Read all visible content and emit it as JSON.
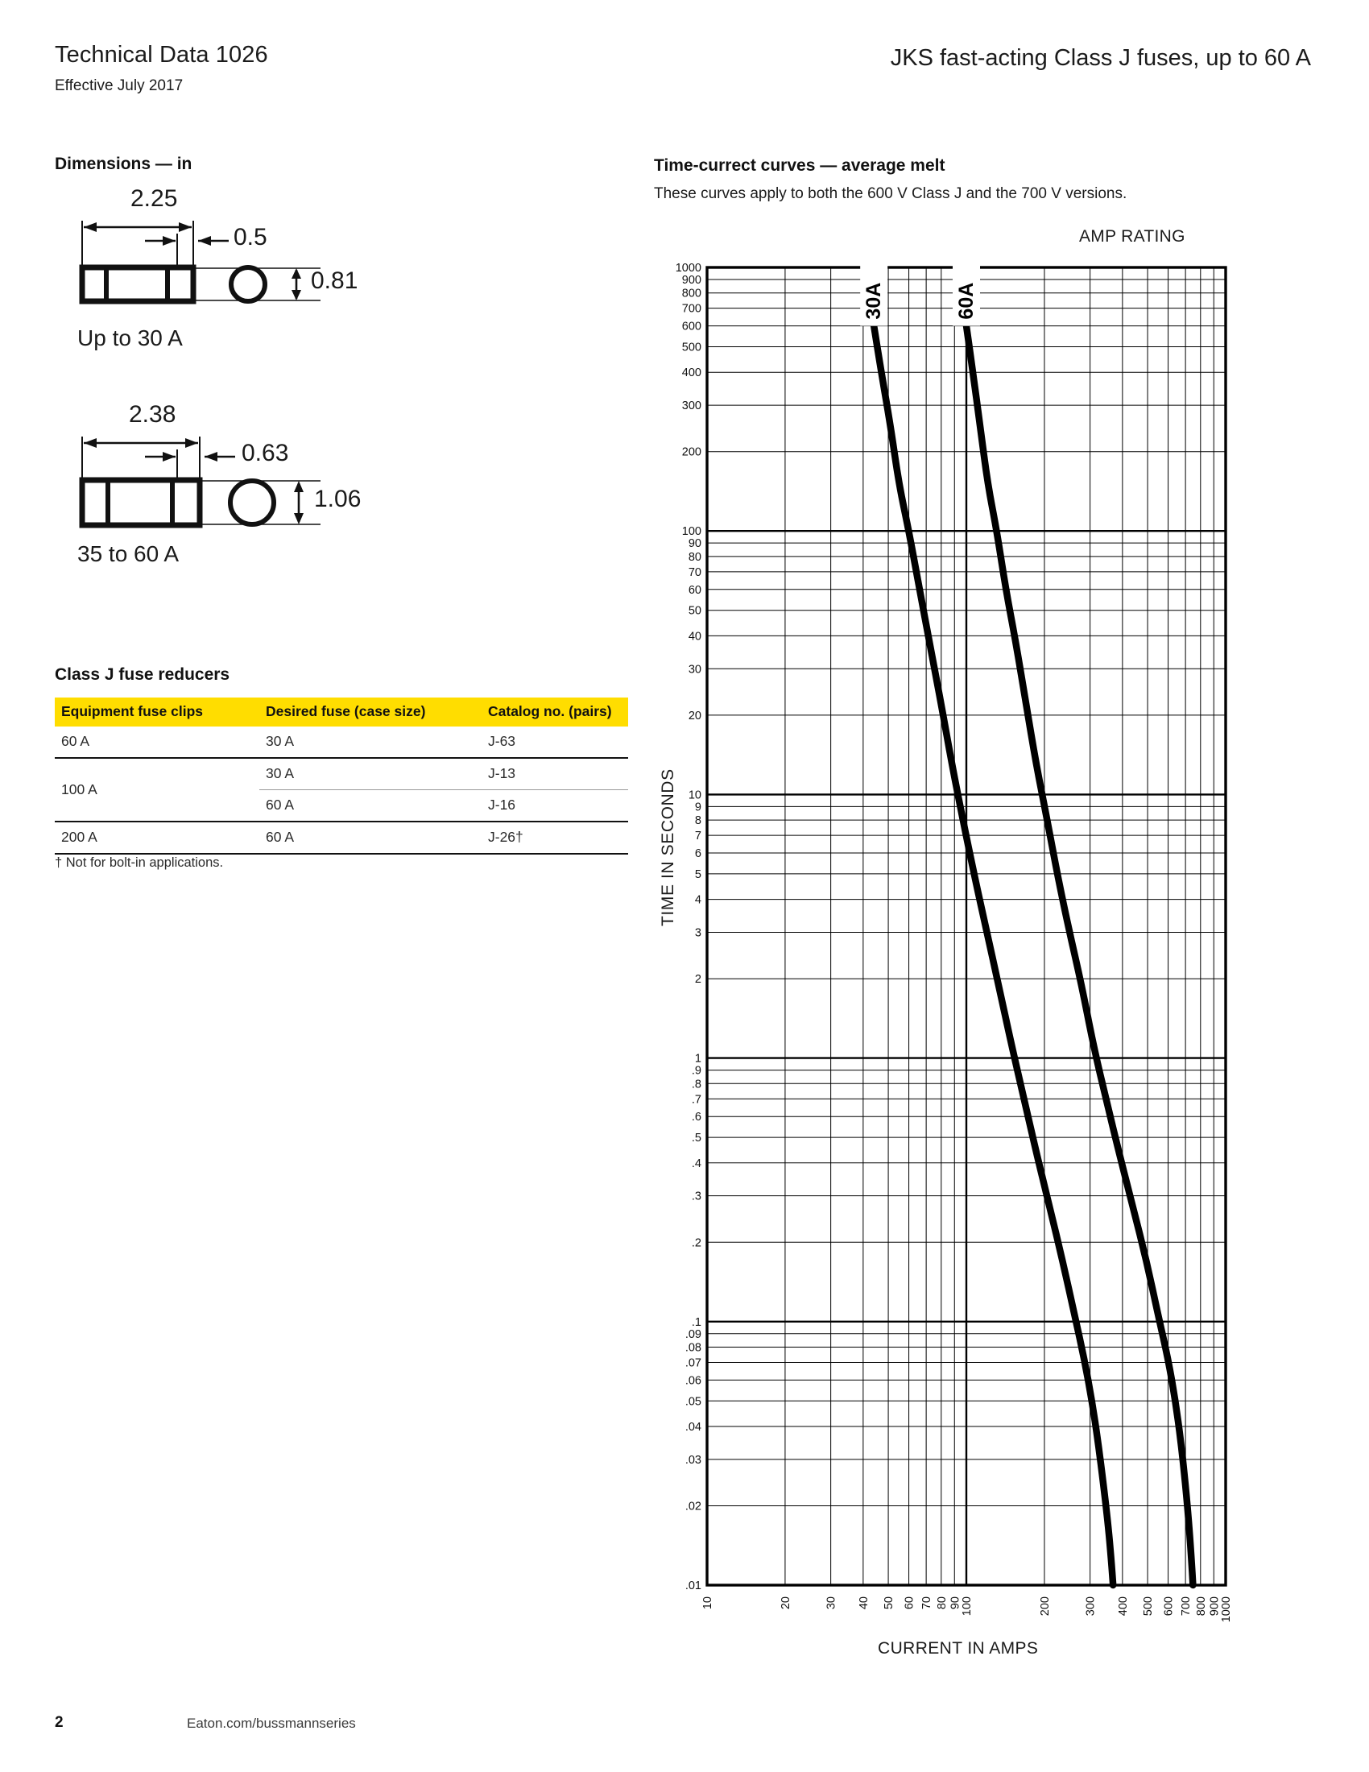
{
  "header": {
    "title": "Technical Data 1026",
    "subtitle": "Effective July 2017",
    "right_title": "JKS fast-acting Class J fuses, up to 60 A"
  },
  "dimensions_section": {
    "title": "Dimensions — in",
    "fuses": [
      {
        "length": "2.25",
        "body_offset": "0.5",
        "diameter": "0.81",
        "caption": "Up to 30 A"
      },
      {
        "length": "2.38",
        "body_offset": "0.63",
        "diameter": "1.06",
        "caption": "35 to 60 A"
      }
    ]
  },
  "reducers_section": {
    "title": "Class J fuse reducers",
    "columns": [
      "Equipment fuse clips",
      "Desired fuse (case size)",
      "Catalog no. (pairs)"
    ],
    "rows": [
      {
        "clips": "60 A",
        "fuse": "30 A",
        "catalog": "J-63"
      },
      {
        "clips": "100 A",
        "fuse": "30 A",
        "catalog": "J-13"
      },
      {
        "clips": "",
        "fuse": "60 A",
        "catalog": "J-16"
      },
      {
        "clips": "200 A",
        "fuse": "60 A",
        "catalog": "J-26†"
      }
    ],
    "footnote": "†  Not for bolt-in applications."
  },
  "curves_section": {
    "title": "Time-currect curves — average melt",
    "description": "These curves apply to both the 600 V Class J and the 700 V versions.",
    "amp_rating_label": "AMP RATING"
  },
  "footer": {
    "page_number": "2",
    "url": "Eaton.com/bussmannseries"
  },
  "colors": {
    "table_header": "#ffdd00",
    "curve": "#000000",
    "grid": "#000000",
    "text": "#1b1b1b"
  },
  "chart_data": {
    "type": "line",
    "title": "Time-currect curves — average melt",
    "xlabel": "CURRENT IN AMPS",
    "ylabel": "TIME IN SECONDS",
    "xscale": "log",
    "yscale": "log",
    "xlim": [
      10,
      1000
    ],
    "ylim": [
      0.01,
      1000
    ],
    "grid": true,
    "legend_position": "in-plot-inline",
    "annotations": [
      "AMP RATING"
    ],
    "x_ticks": [
      10,
      20,
      30,
      40,
      50,
      60,
      70,
      80,
      90,
      100,
      200,
      300,
      400,
      500,
      600,
      700,
      800,
      900,
      1000
    ],
    "x_tick_labels": [
      "10",
      "20",
      "30",
      "40",
      "50",
      "60",
      "70",
      "80",
      "90",
      "100",
      "200",
      "300",
      "400",
      "500",
      "600",
      "700",
      "800",
      "900",
      "1000"
    ],
    "y_ticks": [
      0.01,
      0.02,
      0.03,
      0.04,
      0.05,
      0.06,
      0.07,
      0.08,
      0.09,
      0.1,
      0.2,
      0.3,
      0.4,
      0.5,
      0.6,
      0.7,
      0.8,
      0.9,
      1,
      2,
      3,
      4,
      5,
      6,
      7,
      8,
      9,
      10,
      20,
      30,
      40,
      50,
      60,
      70,
      80,
      90,
      100,
      200,
      300,
      400,
      500,
      600,
      700,
      800,
      900,
      1000
    ],
    "y_tick_labels": [
      ".01",
      ".02",
      ".03",
      ".04",
      ".05",
      ".06",
      ".07",
      ".08",
      ".09",
      ".1",
      ".2",
      ".3",
      ".4",
      ".5",
      ".6",
      ".7",
      ".8",
      ".9",
      "1",
      "2",
      "3",
      "4",
      "5",
      "6",
      "7",
      "8",
      "9",
      "10",
      "20",
      "30",
      "40",
      "50",
      "60",
      "70",
      "80",
      "90",
      "100",
      "200",
      "300",
      "400",
      "500",
      "600",
      "700",
      "800",
      "900",
      "1000"
    ],
    "series": [
      {
        "name": "30A",
        "label": "30A",
        "points": [
          [
            44,
            600
          ],
          [
            47,
            400
          ],
          [
            51,
            250
          ],
          [
            55,
            150
          ],
          [
            60,
            100
          ],
          [
            66,
            60
          ],
          [
            72,
            38
          ],
          [
            80,
            22
          ],
          [
            88,
            13
          ],
          [
            97,
            8
          ],
          [
            108,
            4.8
          ],
          [
            120,
            3.0
          ],
          [
            133,
            1.9
          ],
          [
            150,
            1.1
          ],
          [
            168,
            0.68
          ],
          [
            188,
            0.42
          ],
          [
            210,
            0.27
          ],
          [
            235,
            0.17
          ],
          [
            262,
            0.105
          ],
          [
            285,
            0.072
          ],
          [
            305,
            0.05
          ],
          [
            322,
            0.035
          ],
          [
            338,
            0.024
          ],
          [
            352,
            0.017
          ],
          [
            362,
            0.0125
          ],
          [
            368,
            0.01
          ]
        ]
      },
      {
        "name": "60A",
        "label": "60A",
        "points": [
          [
            100,
            600
          ],
          [
            106,
            400
          ],
          [
            113,
            250
          ],
          [
            121,
            150
          ],
          [
            131,
            100
          ],
          [
            142,
            60
          ],
          [
            155,
            38
          ],
          [
            170,
            22
          ],
          [
            186,
            13
          ],
          [
            205,
            8
          ],
          [
            226,
            4.8
          ],
          [
            250,
            3.0
          ],
          [
            278,
            1.9
          ],
          [
            310,
            1.1
          ],
          [
            348,
            0.68
          ],
          [
            392,
            0.42
          ],
          [
            440,
            0.27
          ],
          [
            495,
            0.17
          ],
          [
            550,
            0.105
          ],
          [
            600,
            0.072
          ],
          [
            640,
            0.05
          ],
          [
            672,
            0.035
          ],
          [
            700,
            0.024
          ],
          [
            722,
            0.017
          ],
          [
            738,
            0.0125
          ],
          [
            748,
            0.01
          ]
        ]
      }
    ]
  }
}
